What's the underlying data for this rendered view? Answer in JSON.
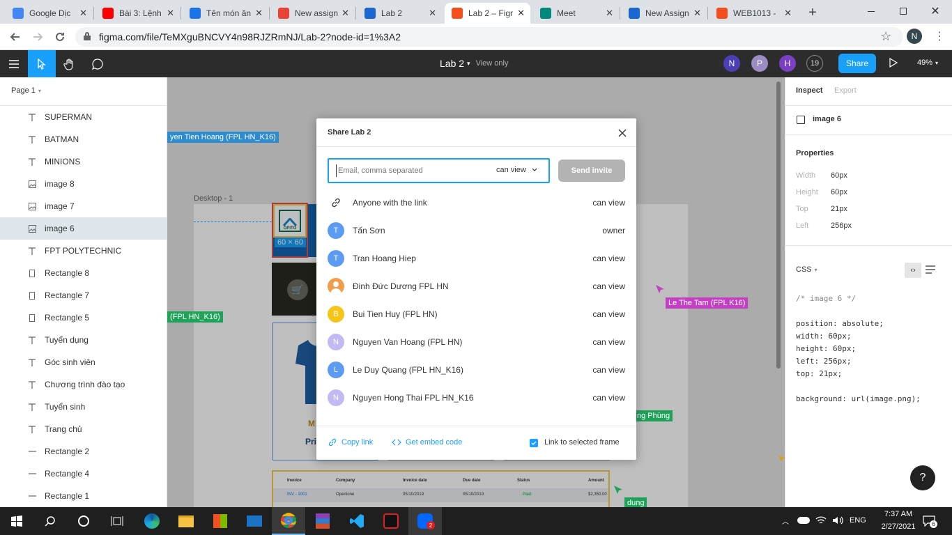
{
  "browser": {
    "tabs": [
      {
        "label": "Google Dịc",
        "fav_color": "#4285f4"
      },
      {
        "label": "Bài 3: Lệnh",
        "fav_color": "#ff0000"
      },
      {
        "label": "Tên món ăn",
        "fav_color": "#1a73e8"
      },
      {
        "label": "New assign",
        "fav_color": "#ea4335"
      },
      {
        "label": "Lab 2",
        "fav_color": "#1967d2"
      },
      {
        "label": "Lab 2 – Figr",
        "fav_color": "#f24e1e"
      },
      {
        "label": "Meet",
        "fav_color": "#00897b"
      },
      {
        "label": "New Assign",
        "fav_color": "#1967d2"
      },
      {
        "label": "WEB1013 -",
        "fav_color": "#f24e1e"
      }
    ],
    "url": "figma.com/file/TeMXguBNCVY4n98RJZRmNJ/Lab-2?node-id=1%3A2",
    "profile_initial": "N"
  },
  "figma": {
    "file_title": "Lab 2",
    "view_mode": "View only",
    "avatars": [
      {
        "initial": "N",
        "color": "#4a3fb5"
      },
      {
        "initial": "P",
        "color": "#9b8cc4"
      },
      {
        "initial": "H",
        "color": "#7b3fc4"
      }
    ],
    "viewer_count": "19",
    "share_label": "Share",
    "zoom": "49%",
    "page_selector": "Page 1",
    "layers": [
      {
        "label": "SUPERMAN",
        "icon": "T"
      },
      {
        "label": "BATMAN",
        "icon": "T"
      },
      {
        "label": "MINIONS",
        "icon": "T"
      },
      {
        "label": "image 8",
        "icon": "img"
      },
      {
        "label": "image 7",
        "icon": "img"
      },
      {
        "label": "image 6",
        "icon": "img"
      },
      {
        "label": "FPT POLYTECHNIC",
        "icon": "T"
      },
      {
        "label": "Rectangle 8",
        "icon": "rect"
      },
      {
        "label": "Rectangle 7",
        "icon": "rect"
      },
      {
        "label": "Rectangle 5",
        "icon": "rect"
      },
      {
        "label": "Tuyển dụng",
        "icon": "T"
      },
      {
        "label": "Góc sinh viên",
        "icon": "T"
      },
      {
        "label": "Chương trình đào tạo",
        "icon": "T"
      },
      {
        "label": "Tuyển sinh",
        "icon": "T"
      },
      {
        "label": "Trang chủ",
        "icon": "T"
      },
      {
        "label": "Rectangle 2",
        "icon": "line"
      },
      {
        "label": "Rectangle 4",
        "icon": "line"
      },
      {
        "label": "Rectangle 1",
        "icon": "line"
      }
    ],
    "selected_layer": "image 6",
    "canvas": {
      "frame_label": "Desktop - 1",
      "size_badge": "60 × 60",
      "logo_text": "OPITO",
      "product_partial": "M",
      "price_partial": "Pri",
      "cursor_labels": [
        {
          "text": "yen Tien Hoang (FPL HN_K16)",
          "color": "#2d8bd0"
        },
        {
          "text": "(FPL HN_K16)",
          "color": "#1fa35b"
        },
        {
          "text": "Le The Tam (FPL K16)",
          "color": "#c43fc4"
        },
        {
          "text": "ng Phùng",
          "color": "#1fa35b"
        },
        {
          "text": "dung",
          "color": "#1fa35b"
        }
      ],
      "invoice_headers": [
        "Invoice",
        "Company",
        "Invoice date",
        "Due date",
        "Status",
        "Amount"
      ],
      "invoice_row": [
        "INV - 1001",
        "Opentone",
        "05/10/2019",
        "05/10/2019",
        "Paid",
        "$2,350.00"
      ]
    },
    "inspect": {
      "tabs": [
        "Inspect",
        "Export"
      ],
      "layer_name": "image 6",
      "properties_title": "Properties",
      "props": [
        {
          "key": "Width",
          "value": "60px"
        },
        {
          "key": "Height",
          "value": "60px"
        },
        {
          "key": "Top",
          "value": "21px"
        },
        {
          "key": "Left",
          "value": "256px"
        }
      ],
      "css_label": "CSS",
      "css_lines": [
        "/* image 6 */",
        "",
        "position: absolute;",
        "width: 60px;",
        "height: 60px;",
        "left: 256px;",
        "top: 21px;",
        "",
        "background: url(image.png);"
      ]
    },
    "help_label": "?"
  },
  "share_dialog": {
    "title": "Share Lab 2",
    "email_placeholder": "Email, comma separated",
    "permission": "can view",
    "send_label": "Send invite",
    "members": [
      {
        "name": "Anyone with the link",
        "role": "can view",
        "avatar": "link",
        "color": ""
      },
      {
        "name": "Tấn Sơn",
        "role": "owner",
        "avatar": "T",
        "color": "#5b9bf3"
      },
      {
        "name": "Tran Hoang Hiep",
        "role": "can view",
        "avatar": "T",
        "color": "#5b9bf3"
      },
      {
        "name": "Đinh Đức Dương FPL HN",
        "role": "can view",
        "avatar": "photo",
        "color": "#f29d49"
      },
      {
        "name": "Bui Tien Huy (FPL HN)",
        "role": "can view",
        "avatar": "B",
        "color": "#f5c518"
      },
      {
        "name": "Nguyen Van Hoang (FPL HN)",
        "role": "can view",
        "avatar": "N",
        "color": "#c3b9f3"
      },
      {
        "name": "Le Duy Quang (FPL HN_K16)",
        "role": "can view",
        "avatar": "L",
        "color": "#5b9bf3"
      },
      {
        "name": "Nguyen Hong Thai FPL HN_K16",
        "role": "can view",
        "avatar": "N",
        "color": "#c3b9f3"
      }
    ],
    "copy_link": "Copy link",
    "embed_code": "Get embed code",
    "link_frame": "Link to selected frame",
    "link_frame_checked": true
  },
  "taskbar": {
    "language": "ENG",
    "time": "7:37 AM",
    "date": "2/27/2021",
    "notification_count": "6",
    "zalo_badge": "2"
  }
}
